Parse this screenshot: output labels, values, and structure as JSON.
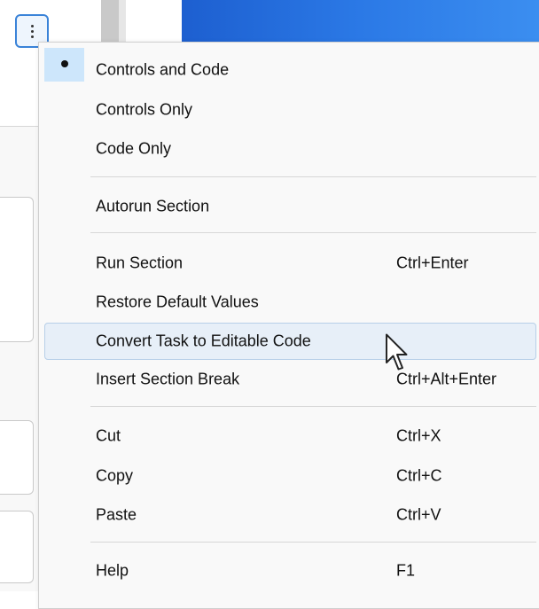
{
  "menu": {
    "items": [
      {
        "label": "Controls and Code",
        "shortcut": "",
        "checked": true
      },
      {
        "label": "Controls Only",
        "shortcut": ""
      },
      {
        "label": "Code Only",
        "shortcut": ""
      },
      {
        "label": "Autorun Section",
        "shortcut": ""
      },
      {
        "label": "Run Section",
        "shortcut": "Ctrl+Enter"
      },
      {
        "label": "Restore Default Values",
        "shortcut": ""
      },
      {
        "label": "Convert Task to Editable Code",
        "shortcut": "",
        "highlighted": true
      },
      {
        "label": "Insert Section Break",
        "shortcut": "Ctrl+Alt+Enter"
      },
      {
        "label": "Cut",
        "shortcut": "Ctrl+X"
      },
      {
        "label": "Copy",
        "shortcut": "Ctrl+C"
      },
      {
        "label": "Paste",
        "shortcut": "Ctrl+V"
      },
      {
        "label": "Help",
        "shortcut": "F1"
      }
    ]
  },
  "colors": {
    "hover": "#e7eff8",
    "check_bg": "#cde6fb",
    "accent": "#3a83d8"
  },
  "icons": {
    "more_button": "vertical-ellipsis-icon",
    "cursor": "mouse-pointer-icon",
    "check": "bullet-dot-icon"
  }
}
